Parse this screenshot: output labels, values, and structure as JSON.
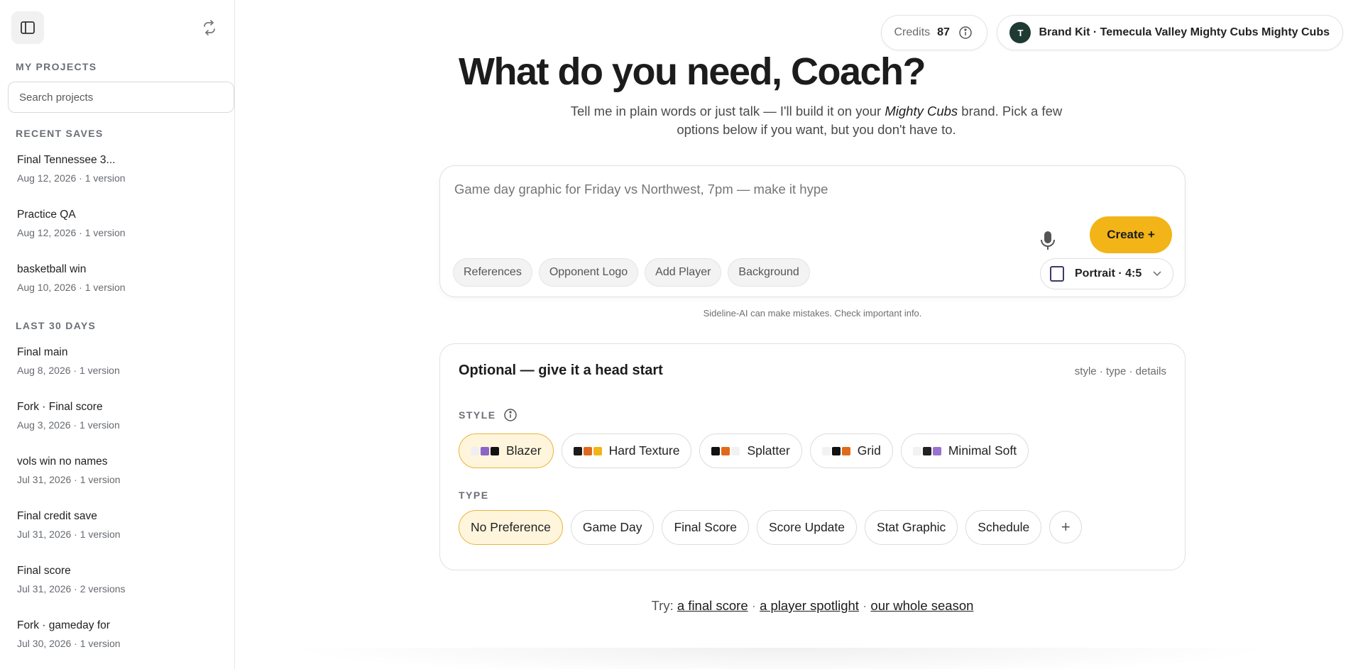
{
  "sidebar": {
    "my_projects_heading": "MY PROJECTS",
    "search_placeholder": "Search projects",
    "recent_heading": "RECENT SAVES",
    "recent": [
      {
        "name": "Final Tennessee 3...",
        "meta": "Aug 12, 2026 · 1 version"
      },
      {
        "name": "Practice QA",
        "meta": "Aug 12, 2026 · 1 version"
      },
      {
        "name": "basketball win",
        "meta": "Aug 10, 2026 · 1 version"
      }
    ],
    "last30_heading": "LAST 30 DAYS",
    "last30": [
      {
        "name": "Final main",
        "meta": "Aug 8, 2026 · 1 version"
      },
      {
        "name": "Fork · Final score",
        "meta": "Aug 3, 2026 · 1 version"
      },
      {
        "name": "vols win no names",
        "meta": "Jul 31, 2026 · 1 version"
      },
      {
        "name": "Final credit save",
        "meta": "Jul 31, 2026 · 1 version"
      },
      {
        "name": "Final score",
        "meta": "Jul 31, 2026 · 2 versions"
      },
      {
        "name": "Fork · gameday for",
        "meta": "Jul 30, 2026 · 1 version"
      }
    ]
  },
  "header": {
    "credits_label": "Credits",
    "credits_value": "87",
    "brand_avatar": "T",
    "brand_kit": "Brand Kit · Temecula Valley Mighty Cubs Mighty Cubs"
  },
  "hero": {
    "title": "What do you need, Coach?",
    "sub_before": "Tell me in plain words or just talk — I'll build it on your ",
    "sub_brand": "Mighty Cubs",
    "sub_after": " brand. Pick a few options below if you want, but you don't have to."
  },
  "composer": {
    "prompt_placeholder": "Game day graphic for Friday vs Northwest, 7pm — make it hype",
    "create_label": "Create +",
    "chips": [
      "References",
      "Opponent Logo",
      "Add Player",
      "Background"
    ],
    "aspect_label": "Portrait · 4:5",
    "disclaimer": "Sideline-AI can make mistakes. Check important info."
  },
  "optional": {
    "title": "Optional — give it a head start",
    "tags": "style · type · details",
    "style_label": "STYLE",
    "styles": [
      {
        "label": "Blazer",
        "selected": true,
        "swatches": [
          "#f0eef3",
          "#8a64c8",
          "#111111"
        ]
      },
      {
        "label": "Hard Texture",
        "selected": false,
        "swatches": [
          "#1a1a1a",
          "#e06a1c",
          "#f2b417"
        ]
      },
      {
        "label": "Splatter",
        "selected": false,
        "swatches": [
          "#111111",
          "#e06a1c",
          "#f2f2f2"
        ]
      },
      {
        "label": "Grid",
        "selected": false,
        "swatches": [
          "#f2f2f2",
          "#111111",
          "#e06a1c"
        ]
      },
      {
        "label": "Minimal Soft",
        "selected": false,
        "swatches": [
          "#f2f2f2",
          "#222222",
          "#9a72d0"
        ]
      }
    ],
    "type_label": "TYPE",
    "types": [
      {
        "label": "No Preference",
        "selected": true
      },
      {
        "label": "Game Day",
        "selected": false
      },
      {
        "label": "Final Score",
        "selected": false
      },
      {
        "label": "Score Update",
        "selected": false
      },
      {
        "label": "Stat Graphic",
        "selected": false
      },
      {
        "label": "Schedule",
        "selected": false
      }
    ],
    "add_type_symbol": "+"
  },
  "try": {
    "prefix": "Try:",
    "links": [
      "a final score",
      "a player spotlight",
      "our whole season"
    ],
    "separator": "·"
  },
  "colors": {
    "accent": "#f2b417",
    "selected_bg": "#fff5dc",
    "selected_border": "#e8b43a",
    "avatar_bg": "#1f3a32"
  },
  "icons": {
    "sidebar_toggle": "sidebar-panel-icon",
    "refresh": "refresh-icon",
    "info": "info-icon",
    "mic": "microphone-icon",
    "aspect": "portrait-frame-icon",
    "chevron": "chevron-down-icon"
  }
}
